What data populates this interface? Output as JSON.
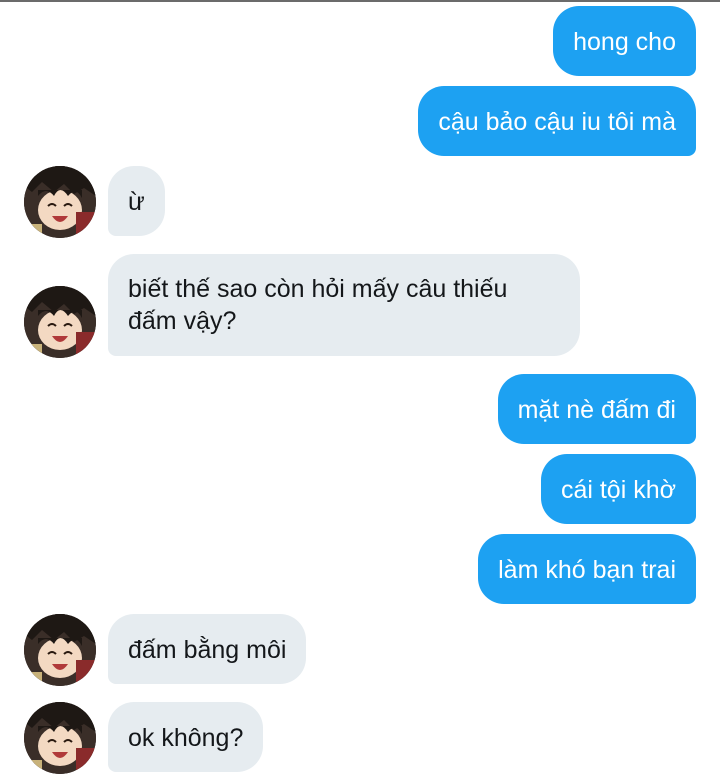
{
  "conversation": {
    "messages": [
      {
        "side": "out",
        "text": "hong cho"
      },
      {
        "side": "out",
        "text": "cậu bảo cậu iu tôi mà"
      },
      {
        "side": "in",
        "text": "ừ"
      },
      {
        "side": "in",
        "text": "biết thế sao còn hỏi mấy câu thiếu đấm vậy?"
      },
      {
        "side": "out",
        "text": "mặt nè đấm đi"
      },
      {
        "side": "out",
        "text": "cái tội khờ"
      },
      {
        "side": "out",
        "text": "làm khó bạn trai"
      },
      {
        "side": "in",
        "text": "đấm bằng môi"
      },
      {
        "side": "in",
        "text": "ok không?"
      }
    ]
  },
  "colors": {
    "outgoing_bubble": "#1da1f2",
    "incoming_bubble": "#e6ecf0",
    "background": "#ffffff"
  },
  "avatar_icon": "anime-boy-laughing-avatar"
}
